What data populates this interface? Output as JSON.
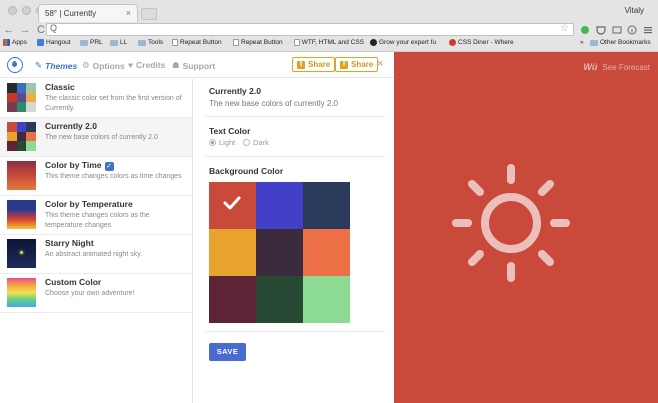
{
  "browser": {
    "tab_title": "58° | Currently",
    "tab_close": "×",
    "profile": "Vitaly",
    "nav": {
      "back": "←",
      "forward": "→",
      "reload": "C"
    },
    "url_icon": "Q",
    "star": "☆",
    "bookmarks": [
      {
        "label": "Apps",
        "icon": "apps-grid-icon"
      },
      {
        "label": "Hangout",
        "icon": "hangout-icon"
      },
      {
        "label": "PRL",
        "icon": "folder-icon"
      },
      {
        "label": "LL",
        "icon": "folder-icon"
      },
      {
        "label": "Tools",
        "icon": "folder-icon"
      },
      {
        "label": "Repeat Button",
        "icon": "page-icon"
      },
      {
        "label": "Repeat Button",
        "icon": "page-icon"
      },
      {
        "label": "WTF, HTML and CSS",
        "icon": "page-icon"
      },
      {
        "label": "Grow your expert fu",
        "icon": "site-icon"
      },
      {
        "label": "CSS Diner - Where",
        "icon": "site-icon"
      }
    ],
    "overflow": "»",
    "other_bookmarks": "Other Bookmarks"
  },
  "toolbar": {
    "tabs": [
      {
        "label": "Themes",
        "icon": "✎",
        "active": true
      },
      {
        "label": "Options",
        "icon": "⚙",
        "active": false
      },
      {
        "label": "Credits",
        "icon": "♥",
        "active": false
      },
      {
        "label": "Support",
        "icon": "☗",
        "active": false
      }
    ],
    "share_twitter": "Share",
    "share_facebook": "Share",
    "twitter_glyph": "t",
    "facebook_glyph": "f",
    "close": "×"
  },
  "themes": [
    {
      "name": "Classic",
      "description": "The classic color set from the first version of Currently.",
      "colors": [
        "#2b2b2b",
        "#3f6cbc",
        "#9fc7a1",
        "#c0392b",
        "#5c4b8a",
        "#e9b04a",
        "#7a3b4f",
        "#2f8a6b",
        "#d6d6d6"
      ]
    },
    {
      "name": "Currently 2.0",
      "description": "The new base colors of currently 2.0",
      "colors": [
        "#c94a3a",
        "#4340c8",
        "#2a3a5a",
        "#e8a22e",
        "#3c2a3e",
        "#ec6f46",
        "#5c2434",
        "#284a34",
        "#8dda92"
      ],
      "selected": true
    },
    {
      "name": "Color by Time",
      "description": "This theme changes colors as time changes",
      "badge": "✓",
      "gradient": [
        "#8a2f42",
        "#c74a3a",
        "#e6793a"
      ]
    },
    {
      "name": "Color by Temperature",
      "description": "This theme changes colors as the temperature changes",
      "gradient": [
        "#2b3a8f",
        "#2b3a8f",
        "#d84030",
        "#f2c530"
      ]
    },
    {
      "name": "Starry Night",
      "description": "An abstract animated night sky.",
      "gradient": [
        "#0d1437",
        "#1d2b5c"
      ]
    },
    {
      "name": "Custom Color",
      "description": "Choose your own adventure!",
      "gradient": [
        "#e84e8a",
        "#f4a340",
        "#f6e04a",
        "#5dd089",
        "#4aa6e8"
      ]
    }
  ],
  "detail": {
    "title": "Currently 2.0",
    "subtitle": "The new base colors of currently 2.0",
    "text_color_label": "Text Color",
    "text_options": [
      {
        "label": "Light",
        "selected": true
      },
      {
        "label": "Dark",
        "selected": false
      }
    ],
    "background_label": "Background Color",
    "swatches": [
      "#c94a3a",
      "#4340c8",
      "#2a3a5a",
      "#e8a22e",
      "#3c2a3e",
      "#ec6f46",
      "#5c2434",
      "#284a34",
      "#8dda92"
    ],
    "selected_swatch": 0,
    "save_label": "SAVE"
  },
  "preview": {
    "background": "#c94a3a",
    "brand_mark": "Wü",
    "brand_text": "See Forecast",
    "weather_icon": "sun-icon"
  }
}
